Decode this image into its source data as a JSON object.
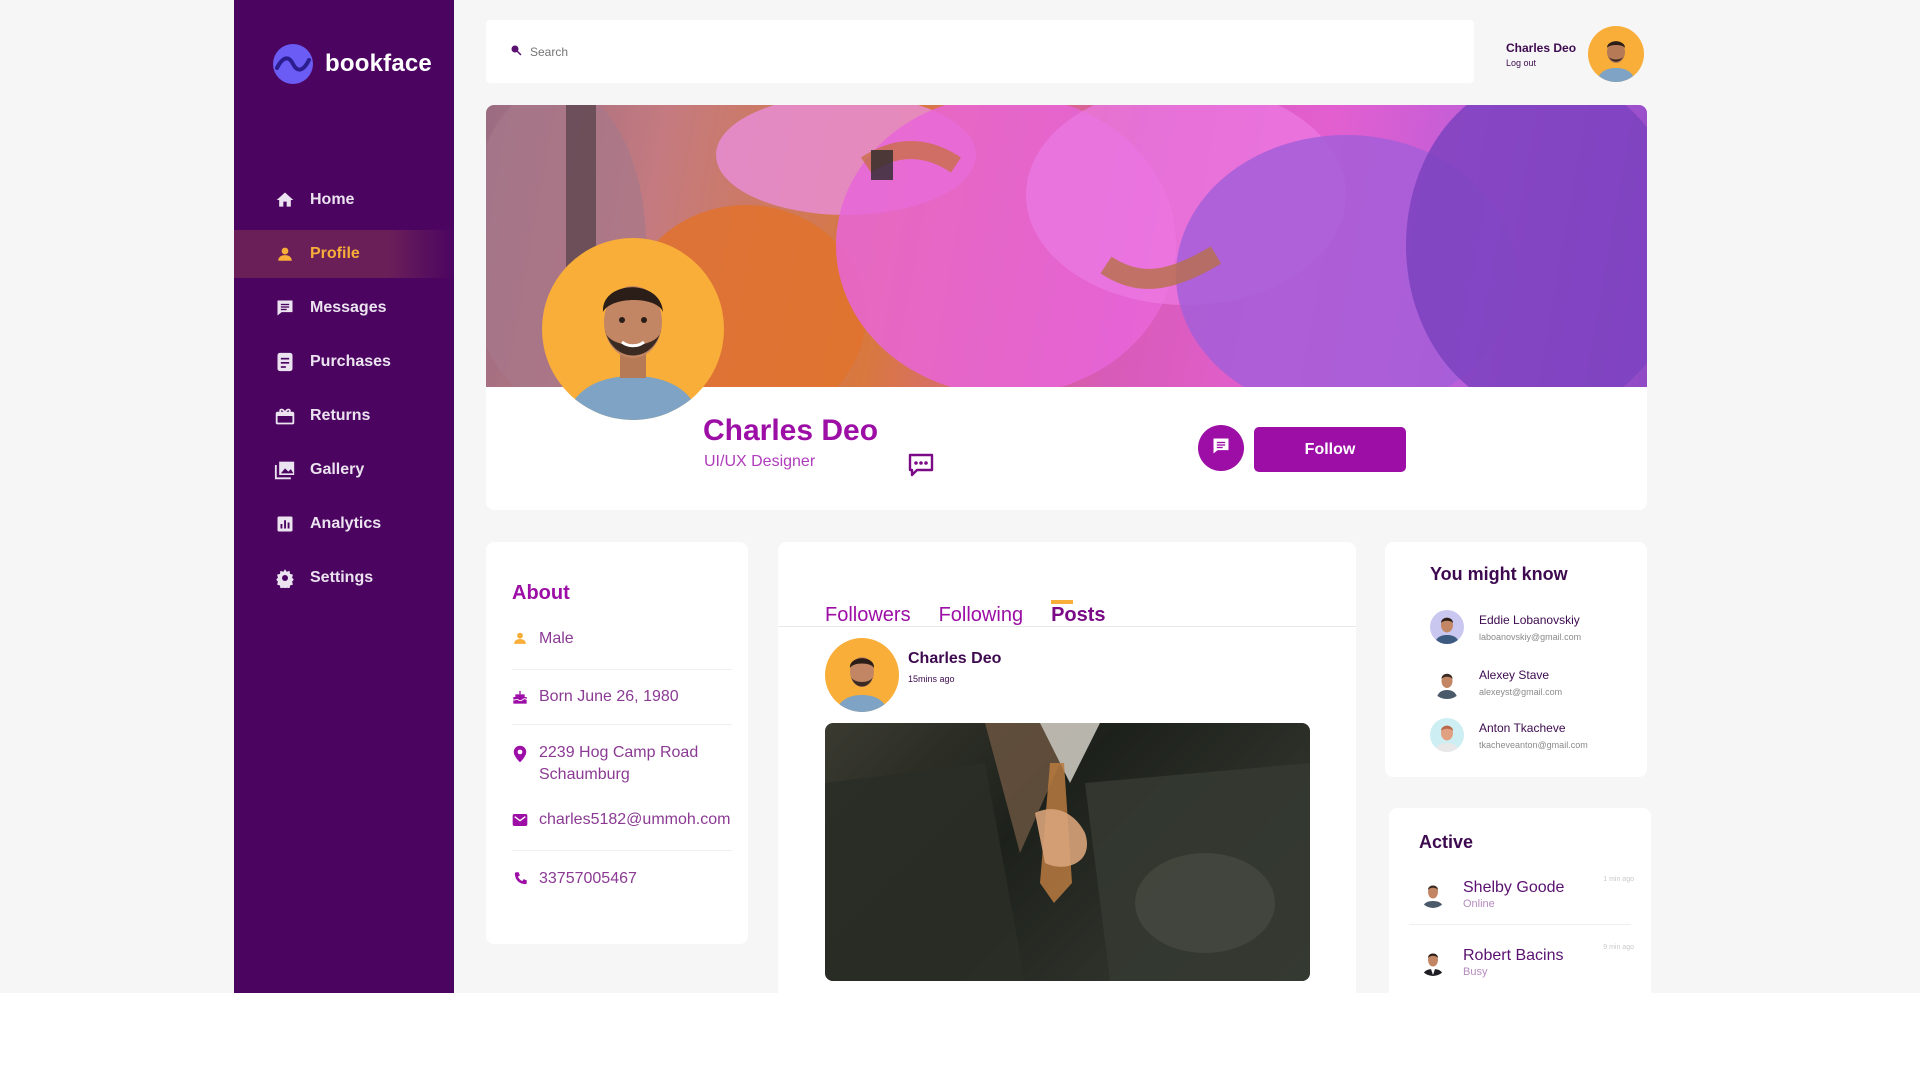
{
  "app": {
    "name": "bookface"
  },
  "colors": {
    "sidebar": "#4b0561",
    "accent": "#9c0ea6",
    "highlight": "#f8ae38",
    "background": "#f6f6f6"
  },
  "sidebar": {
    "items": [
      {
        "label": "Home",
        "icon": "home-icon",
        "active": false
      },
      {
        "label": "Profile",
        "icon": "person-icon",
        "active": true
      },
      {
        "label": "Messages",
        "icon": "message-icon",
        "active": false
      },
      {
        "label": "Purchases",
        "icon": "receipt-icon",
        "active": false
      },
      {
        "label": "Returns",
        "icon": "gift-box-icon",
        "active": false
      },
      {
        "label": "Gallery",
        "icon": "photo-library-icon",
        "active": false
      },
      {
        "label": "Analytics",
        "icon": "bar-chart-icon",
        "active": false
      },
      {
        "label": "Settings",
        "icon": "gear-icon",
        "active": false
      }
    ]
  },
  "topbar": {
    "search_placeholder": "Search",
    "user_name": "Charles Deo",
    "logout_label": "Log out"
  },
  "profile": {
    "name": "Charles Deo",
    "role": "UI/UX Designer",
    "follow_label": "Follow"
  },
  "about": {
    "title": "About",
    "gender": "Male",
    "birth": "Born June 26, 1980",
    "address_line1": "2239  Hog Camp Road",
    "address_line2": "Schaumburg",
    "email": "charles5182@ummoh.com",
    "phone": "33757005467"
  },
  "feed": {
    "tabs": [
      {
        "label": "Followers",
        "active": false
      },
      {
        "label": "Following",
        "active": false
      },
      {
        "label": "Posts",
        "active": true
      }
    ],
    "post": {
      "author": "Charles Deo",
      "time": "15mins ago"
    }
  },
  "might_know": {
    "title": "You might know",
    "people": [
      {
        "name": "Eddie Lobanovskiy",
        "email": "laboanovskiy@gmail.com"
      },
      {
        "name": "Alexey Stave",
        "email": "alexeyst@gmail.com"
      },
      {
        "name": "Anton Tkacheve",
        "email": "tkacheveanton@gmail.com"
      }
    ]
  },
  "active": {
    "title": "Active",
    "people": [
      {
        "name": "Shelby Goode",
        "status": "Online",
        "time": "1 min ago"
      },
      {
        "name": "Robert Bacins",
        "status": "Busy",
        "time": "9 min ago"
      }
    ]
  }
}
